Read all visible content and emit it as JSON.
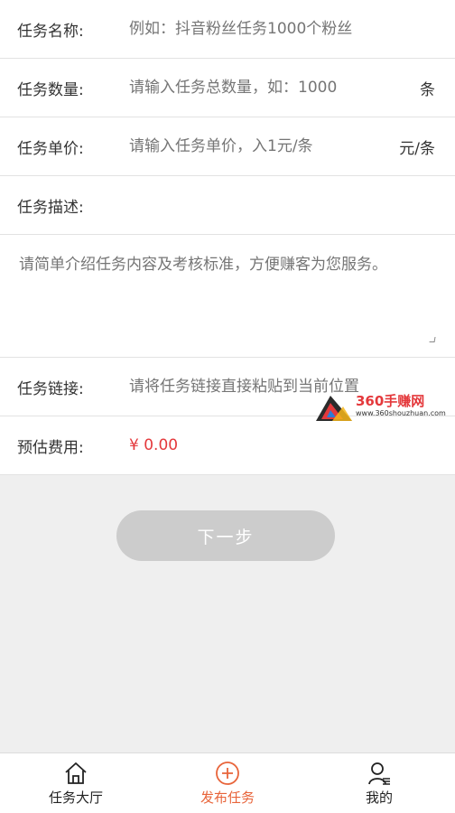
{
  "form": {
    "task_name": {
      "label": "任务名称:",
      "placeholder": "例如：抖音粉丝任务1000个粉丝"
    },
    "task_quantity": {
      "label": "任务数量:",
      "placeholder": "请输入任务总数量，如：1000",
      "unit": "条"
    },
    "task_price": {
      "label": "任务单价:",
      "placeholder": "请输入任务单价，入1元/条",
      "unit": "元/条"
    },
    "task_desc": {
      "label": "任务描述:",
      "placeholder": "请简单介绍任务内容及考核标准，方便赚客为您服务。"
    },
    "task_link": {
      "label": "任务链接:",
      "placeholder": "请将任务链接直接粘贴到当前位置"
    },
    "estimated_cost": {
      "label": "预估费用:",
      "value": "¥ 0.00"
    }
  },
  "watermark": {
    "title": "360手赚网",
    "url": "www.360shouzhuan.com"
  },
  "next_button": {
    "label": "下一步"
  },
  "tabbar": {
    "items": [
      {
        "label": "任务大厅",
        "icon": "home-icon"
      },
      {
        "label": "发布任务",
        "icon": "add-circle-icon",
        "active": true
      },
      {
        "label": "我的",
        "icon": "user-icon"
      }
    ]
  },
  "colors": {
    "accent": "#e8643a",
    "price": "#e4393c",
    "button_disabled": "#cccccc"
  }
}
